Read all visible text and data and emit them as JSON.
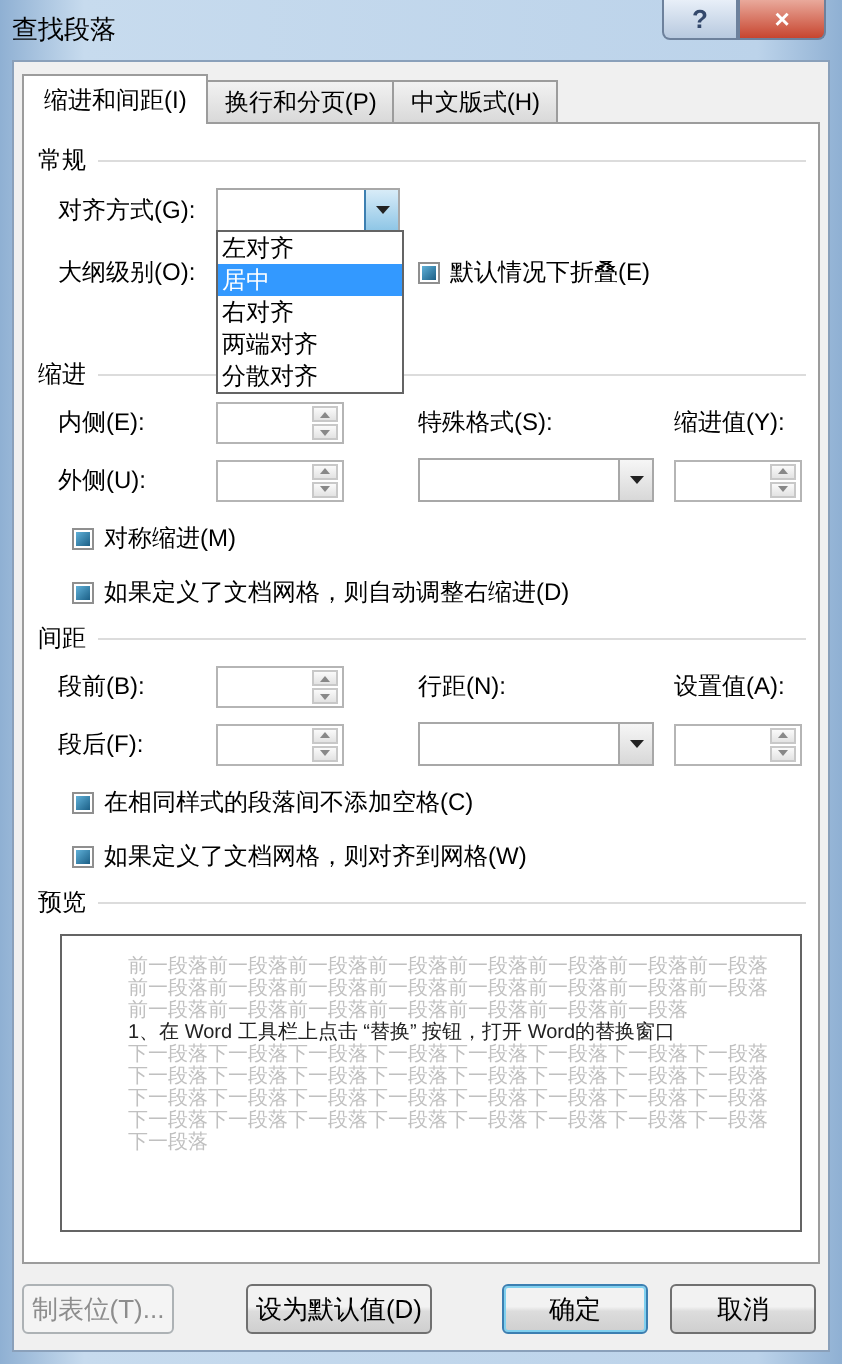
{
  "window": {
    "title": "查找段落"
  },
  "title_buttons": [
    {
      "kind": "help",
      "label": "?"
    },
    {
      "kind": "close",
      "label": "×"
    }
  ],
  "tabs": [
    {
      "label": "缩进和间距(I)",
      "selected": true
    },
    {
      "label": "换行和分页(P)",
      "selected": false
    },
    {
      "label": "中文版式(H)",
      "selected": false
    }
  ],
  "general": {
    "heading": "常规",
    "alignment": {
      "label": "对齐方式(G):",
      "expanded": true,
      "options": [
        {
          "label": "左对齐",
          "selected": false
        },
        {
          "label": "居中",
          "selected": true
        },
        {
          "label": "右对齐",
          "selected": false
        },
        {
          "label": "两端对齐",
          "selected": false
        },
        {
          "label": "分散对齐",
          "selected": false
        }
      ]
    },
    "outline": {
      "label": "大纲级别(O):"
    },
    "collapse": {
      "label": "默认情况下折叠(E)",
      "indeterminate": true
    }
  },
  "indent": {
    "heading": "缩进",
    "inside": {
      "label": "内侧(E):"
    },
    "outside": {
      "label": "外侧(U):"
    },
    "special": {
      "label": "特殊格式(S):"
    },
    "by": {
      "label": "缩进值(Y):"
    },
    "checks": [
      {
        "label": "对称缩进(M)",
        "indeterminate": true
      },
      {
        "label": "如果定义了文档网格，则自动调整右缩进(D)",
        "indeterminate": true
      }
    ]
  },
  "spacing": {
    "heading": "间距",
    "before": {
      "label": "段前(B):"
    },
    "after": {
      "label": "段后(F):"
    },
    "line": {
      "label": "行距(N):"
    },
    "at": {
      "label": "设置值(A):"
    },
    "checks": [
      {
        "label": "在相同样式的段落间不添加空格(C)",
        "indeterminate": true
      },
      {
        "label": "如果定义了文档网格，则对齐到网格(W)",
        "indeterminate": true
      }
    ]
  },
  "preview": {
    "heading": "预览",
    "before": "前一段落前一段落前一段落前一段落前一段落前一段落前一段落前一段落前一段落前一段落前一段落前一段落前一段落前一段落前一段落前一段落前一段落前一段落前一段落前一段落前一段落前一段落前一段落",
    "sample": "1、在 Word 工具栏上点击 “替换” 按钮，打开 Word的替换窗口",
    "after": "下一段落下一段落下一段落下一段落下一段落下一段落下一段落下一段落下一段落下一段落下一段落下一段落下一段落下一段落下一段落下一段落下一段落下一段落下一段落下一段落下一段落下一段落下一段落下一段落下一段落下一段落下一段落下一段落下一段落下一段落下一段落下一段落下一段落"
  },
  "buttons": [
    {
      "label": "制表位(T)...",
      "disabled": true,
      "default": false
    },
    {
      "label": "设为默认值(D)",
      "disabled": false,
      "default": false
    },
    {
      "label": "确定",
      "disabled": false,
      "default": true
    },
    {
      "label": "取消",
      "disabled": false,
      "default": false
    }
  ]
}
